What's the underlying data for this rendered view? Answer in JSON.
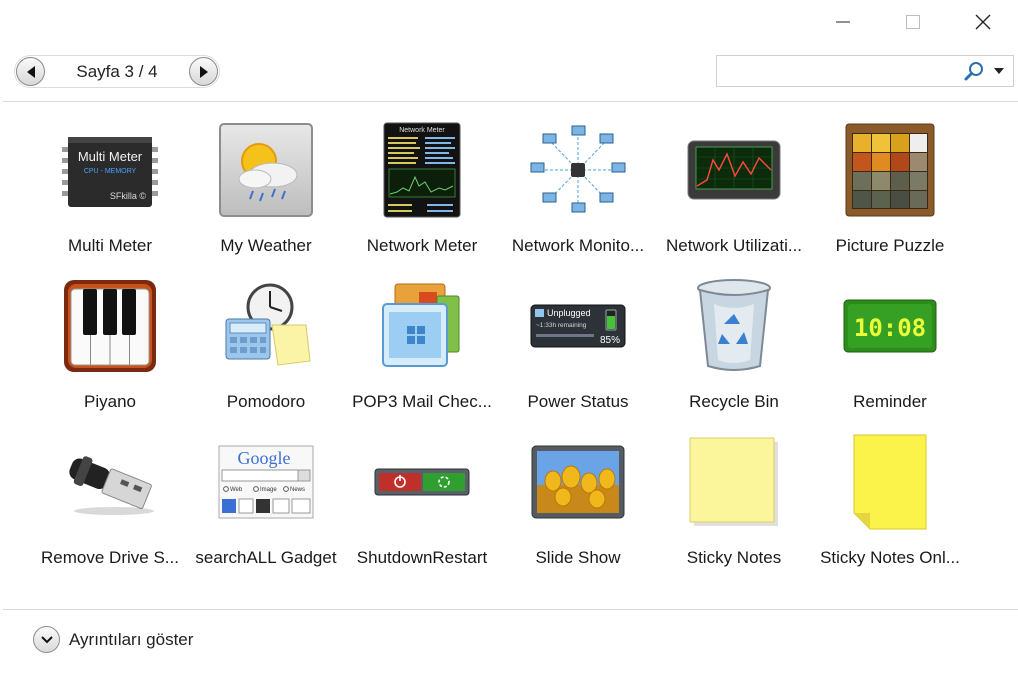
{
  "window": {
    "controls": {
      "minimize": "minimize-icon",
      "maximize": "maximize-icon",
      "close": "close-icon"
    }
  },
  "pager": {
    "label": "Sayfa 3 / 4"
  },
  "search": {
    "value": "",
    "placeholder": ""
  },
  "gadgets": [
    {
      "label": "Multi Meter",
      "icon": "multi-meter-icon",
      "chip_title": "Multi Meter",
      "chip_sub": "CPU - MEMORY",
      "chip_author": "SFkilla ©"
    },
    {
      "label": "My Weather",
      "icon": "weather-icon"
    },
    {
      "label": "Network Meter",
      "icon": "network-meter-icon",
      "panel_title": "Network Meter"
    },
    {
      "label": "Network Monito...",
      "icon": "network-monitor-icon"
    },
    {
      "label": "Network Utilizati...",
      "icon": "network-utilization-icon"
    },
    {
      "label": "Picture Puzzle",
      "icon": "picture-puzzle-icon"
    },
    {
      "label": "Piyano",
      "icon": "piano-icon"
    },
    {
      "label": "Pomodoro",
      "icon": "pomodoro-icon"
    },
    {
      "label": "POP3 Mail Chec...",
      "icon": "mail-checker-icon"
    },
    {
      "label": "Power Status",
      "icon": "power-status-icon",
      "status_line1": "Unplugged",
      "status_line2": "~1:33h remaining",
      "percent": "85%"
    },
    {
      "label": "Recycle Bin",
      "icon": "recycle-bin-icon"
    },
    {
      "label": "Reminder",
      "icon": "reminder-icon",
      "clock": "10:08"
    },
    {
      "label": "Remove Drive S...",
      "icon": "usb-drive-icon"
    },
    {
      "label": "searchALL Gadget",
      "icon": "search-all-icon",
      "brand": "Google",
      "options": [
        "Web",
        "Image",
        "News"
      ]
    },
    {
      "label": "ShutdownRestart",
      "icon": "shutdown-restart-icon"
    },
    {
      "label": "Slide Show",
      "icon": "slide-show-icon"
    },
    {
      "label": "Sticky Notes",
      "icon": "sticky-note-icon"
    },
    {
      "label": "Sticky Notes Onl...",
      "icon": "sticky-note-online-icon"
    }
  ],
  "footer": {
    "details_label": "Ayrıntıları göster"
  },
  "colors": {
    "border": "#d6d6d6",
    "text": "#1a1a1a",
    "reminder_green": "#2e8b1e",
    "sticky_yellow": "#fbf59c"
  }
}
